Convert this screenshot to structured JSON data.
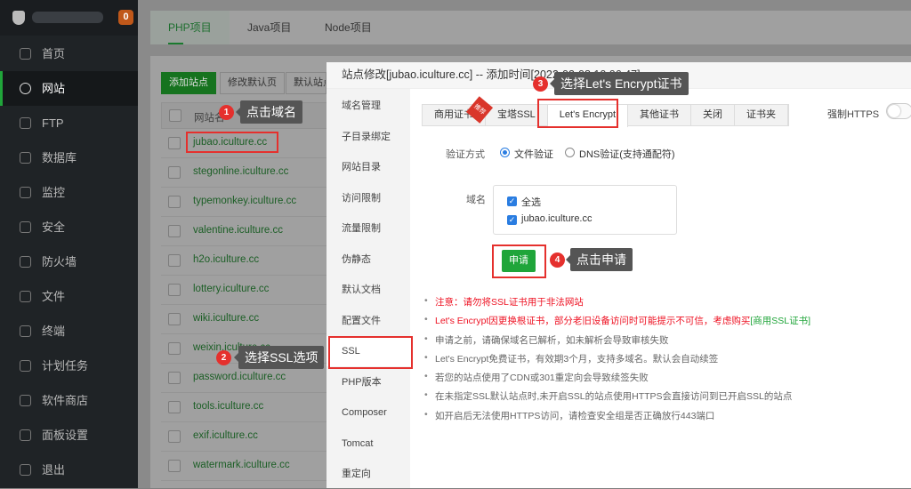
{
  "sidebar": {
    "badge": "0",
    "items": [
      "首页",
      "网站",
      "FTP",
      "数据库",
      "监控",
      "安全",
      "防火墙",
      "文件",
      "终端",
      "计划任务",
      "软件商店",
      "面板设置",
      "退出"
    ]
  },
  "main": {
    "tabs": [
      "PHP项目",
      "Java项目",
      "Node项目"
    ],
    "buttons": [
      "添加站点",
      "修改默认页",
      "默认站点"
    ],
    "col_header": "网站名",
    "sites": [
      "jubao.iculture.cc",
      "stegonline.iculture.cc",
      "typemonkey.iculture.cc",
      "valentine.iculture.cc",
      "h2o.iculture.cc",
      "lottery.iculture.cc",
      "wiki.iculture.cc",
      "weixin.iculture.cc",
      "password.iculture.cc",
      "tools.iculture.cc",
      "exif.iculture.cc",
      "watermark.iculture.cc"
    ]
  },
  "modal": {
    "title": "站点修改[jubao.iculture.cc] -- 添加时间[2022-03-08 10:06:47]",
    "menu": [
      "域名管理",
      "子目录绑定",
      "网站目录",
      "访问限制",
      "流量限制",
      "伪静态",
      "默认文档",
      "配置文件",
      "SSL",
      "PHP版本",
      "Composer",
      "Tomcat",
      "重定向"
    ],
    "tabs": [
      "商用证书",
      "宝塔SSL",
      "Let's Encrypt",
      "其他证书",
      "关闭",
      "证书夹"
    ],
    "ribbon": "推荐",
    "force_https": "强制HTTPS",
    "verify_label": "验证方式",
    "verify_options": [
      "文件验证",
      "DNS验证(支持通配符)"
    ],
    "domain_label": "域名",
    "domains": [
      "全选",
      "jubao.iculture.cc"
    ],
    "apply": "申请",
    "notes": [
      "注意：请勿将SSL证书用于非法网站",
      "Let's Encrypt因更换根证书，部分老旧设备访问时可能提示不可信，考虑购买",
      "申请之前，请确保域名已解析，如未解析会导致审核失败",
      "Let's Encrypt免费证书，有效期3个月，支持多域名。默认会自动续签",
      "若您的站点使用了CDN或301重定向会导致续签失败",
      "在未指定SSL默认站点时,未开启SSL的站点使用HTTPS会直接访问到已开启SSL的站点",
      "如开启后无法使用HTTPS访问，请检查安全组是否正确放行443端口"
    ],
    "note_link": "[商用SSL证书]"
  },
  "annotations": [
    {
      "n": "1",
      "text": "点击域名"
    },
    {
      "n": "2",
      "text": "选择SSL选项"
    },
    {
      "n": "3",
      "text": "选择Let's Encrypt证书"
    },
    {
      "n": "4",
      "text": "点击申请"
    }
  ]
}
